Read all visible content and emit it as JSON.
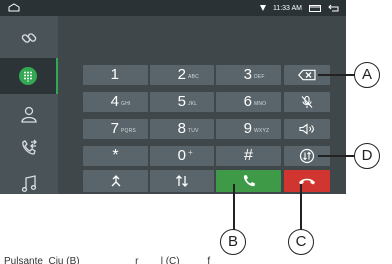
{
  "status_bar": {
    "time": "11:33 AM"
  },
  "sidebar": {
    "items": [
      {
        "icon": "link-icon"
      },
      {
        "icon": "dialpad-icon",
        "active": true
      },
      {
        "icon": "contacts-icon"
      },
      {
        "icon": "call-log-icon"
      },
      {
        "icon": "music-icon"
      }
    ]
  },
  "keypad": {
    "keys": [
      {
        "num": "1",
        "sub": ""
      },
      {
        "num": "2",
        "sub": "ABC"
      },
      {
        "num": "3",
        "sub": "DEF"
      },
      {
        "num": "4",
        "sub": "GHI"
      },
      {
        "num": "5",
        "sub": "JKL"
      },
      {
        "num": "6",
        "sub": "MNO"
      },
      {
        "num": "7",
        "sub": "PQRS"
      },
      {
        "num": "8",
        "sub": "TUV"
      },
      {
        "num": "9",
        "sub": "WXYZ"
      },
      {
        "num": "*",
        "sub": ""
      },
      {
        "num": "0",
        "sub": "+"
      },
      {
        "num": "#",
        "sub": ""
      }
    ],
    "side_icons": [
      "backspace-icon",
      "mic-mute-icon",
      "speaker-icon",
      "call-switch-icon"
    ],
    "bottom_icons": [
      "transfer-icon",
      "swap-icon",
      "call-answer-icon",
      "call-end-icon"
    ],
    "colors": {
      "answer": "#3e9a46",
      "end": "#d0352f",
      "active_accent": "#33a852"
    }
  },
  "callouts": {
    "a": "A",
    "b": "B",
    "c": "C",
    "d": "D"
  },
  "caption": "Pulsante  Ciu (B)                    r        l (C)          f"
}
